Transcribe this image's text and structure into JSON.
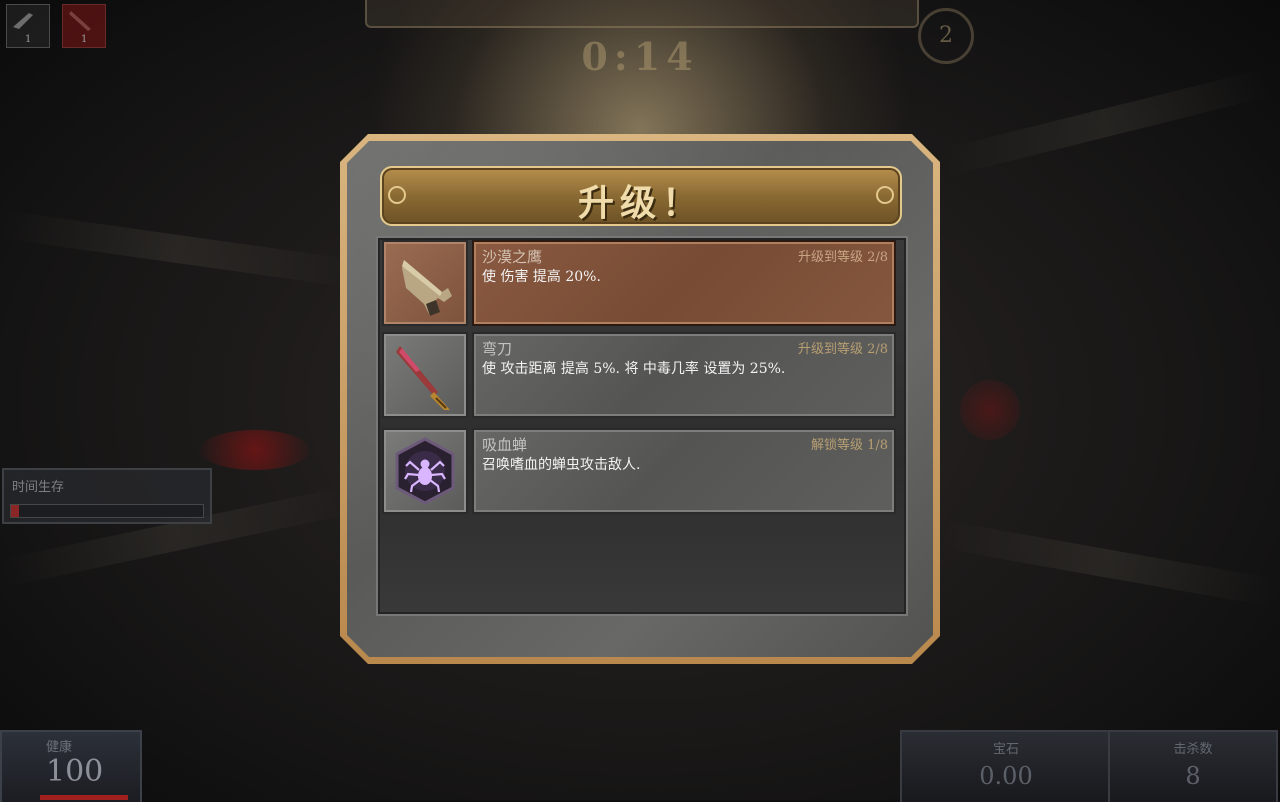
{
  "hud": {
    "weapon_slots": [
      {
        "level": "1"
      },
      {
        "level": "1"
      }
    ],
    "xp_text": "",
    "timer": "0:14",
    "player_level": "2",
    "survival_label": "时间生存",
    "survival_progress": 0.04,
    "health_label": "健康",
    "health_value": "100",
    "gems_label": "宝石",
    "gems_value": "0.00",
    "kills_label": "击杀数",
    "kills_value": "8"
  },
  "dialog": {
    "title": "升级！",
    "options": [
      {
        "icon": "desert-eagle-pistol-icon",
        "name": "沙漠之鹰",
        "level": "升级到等级 2/8",
        "description": "使 伤害 提高 20%.",
        "selected": true
      },
      {
        "icon": "machete-icon",
        "name": "弯刀",
        "level": "升级到等级 2/8",
        "description": "使 攻击距离 提高 5%. 将 中毒几率 设置为 25%.",
        "selected": false
      },
      {
        "icon": "spider-tick-icon",
        "name": "吸血蝉",
        "level": "解锁等级 1/8",
        "description": "召唤嗜血的蝉虫攻击敌人.",
        "selected": false
      }
    ]
  },
  "colors": {
    "frame_gold": "#d9b57f",
    "selected_option": "#8a5a41",
    "title_text": "#f0dcaa",
    "level_text": "#b89f72"
  }
}
